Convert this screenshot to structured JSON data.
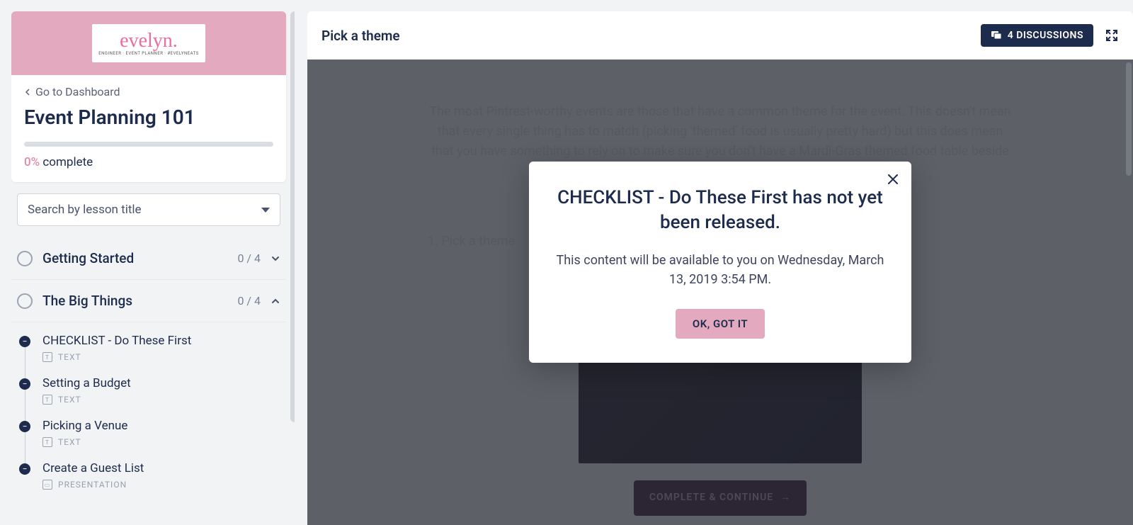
{
  "brand": {
    "name": "evelyn.",
    "tagline": "ENGINEER · EVENT PLANNER · #EVELYNEATS"
  },
  "sidebar": {
    "back_label": "Go to Dashboard",
    "course_title": "Event Planning 101",
    "progress_pct": "0%",
    "progress_word": "complete",
    "search_placeholder": "Search by lesson title",
    "chapters": [
      {
        "title": "Getting Started",
        "count": "0 / 4",
        "expanded": false
      },
      {
        "title": "The Big Things",
        "count": "0 / 4",
        "expanded": true
      }
    ],
    "lessons": [
      {
        "title": "CHECKLIST - Do These First",
        "type": "TEXT"
      },
      {
        "title": "Setting a Budget",
        "type": "TEXT"
      },
      {
        "title": "Picking a Venue",
        "type": "TEXT"
      },
      {
        "title": "Create a Guest List",
        "type": "PRESENTATION"
      }
    ]
  },
  "content": {
    "header_title": "Pick a theme",
    "discussions_label": "4 DISCUSSIONS",
    "paragraph": "The most Pintrest-worthy events are those that have a common theme for the event. This doesn't mean that every single thing has to match (picking 'themed' food is usually pretty hard) but this does mean that you have something to rely on to make sure you don't have a Mardi-Gras themed food table beside a Hawaiian themed gift table.",
    "step1": "1. Pick a theme",
    "complete_label": "COMPLETE & CONTINUE"
  },
  "modal": {
    "title": "CHECKLIST - Do These First has not yet been released.",
    "body": "This content will be available to you on Wednesday, March 13, 2019 3:54 PM.",
    "button": "OK, GOT IT"
  }
}
